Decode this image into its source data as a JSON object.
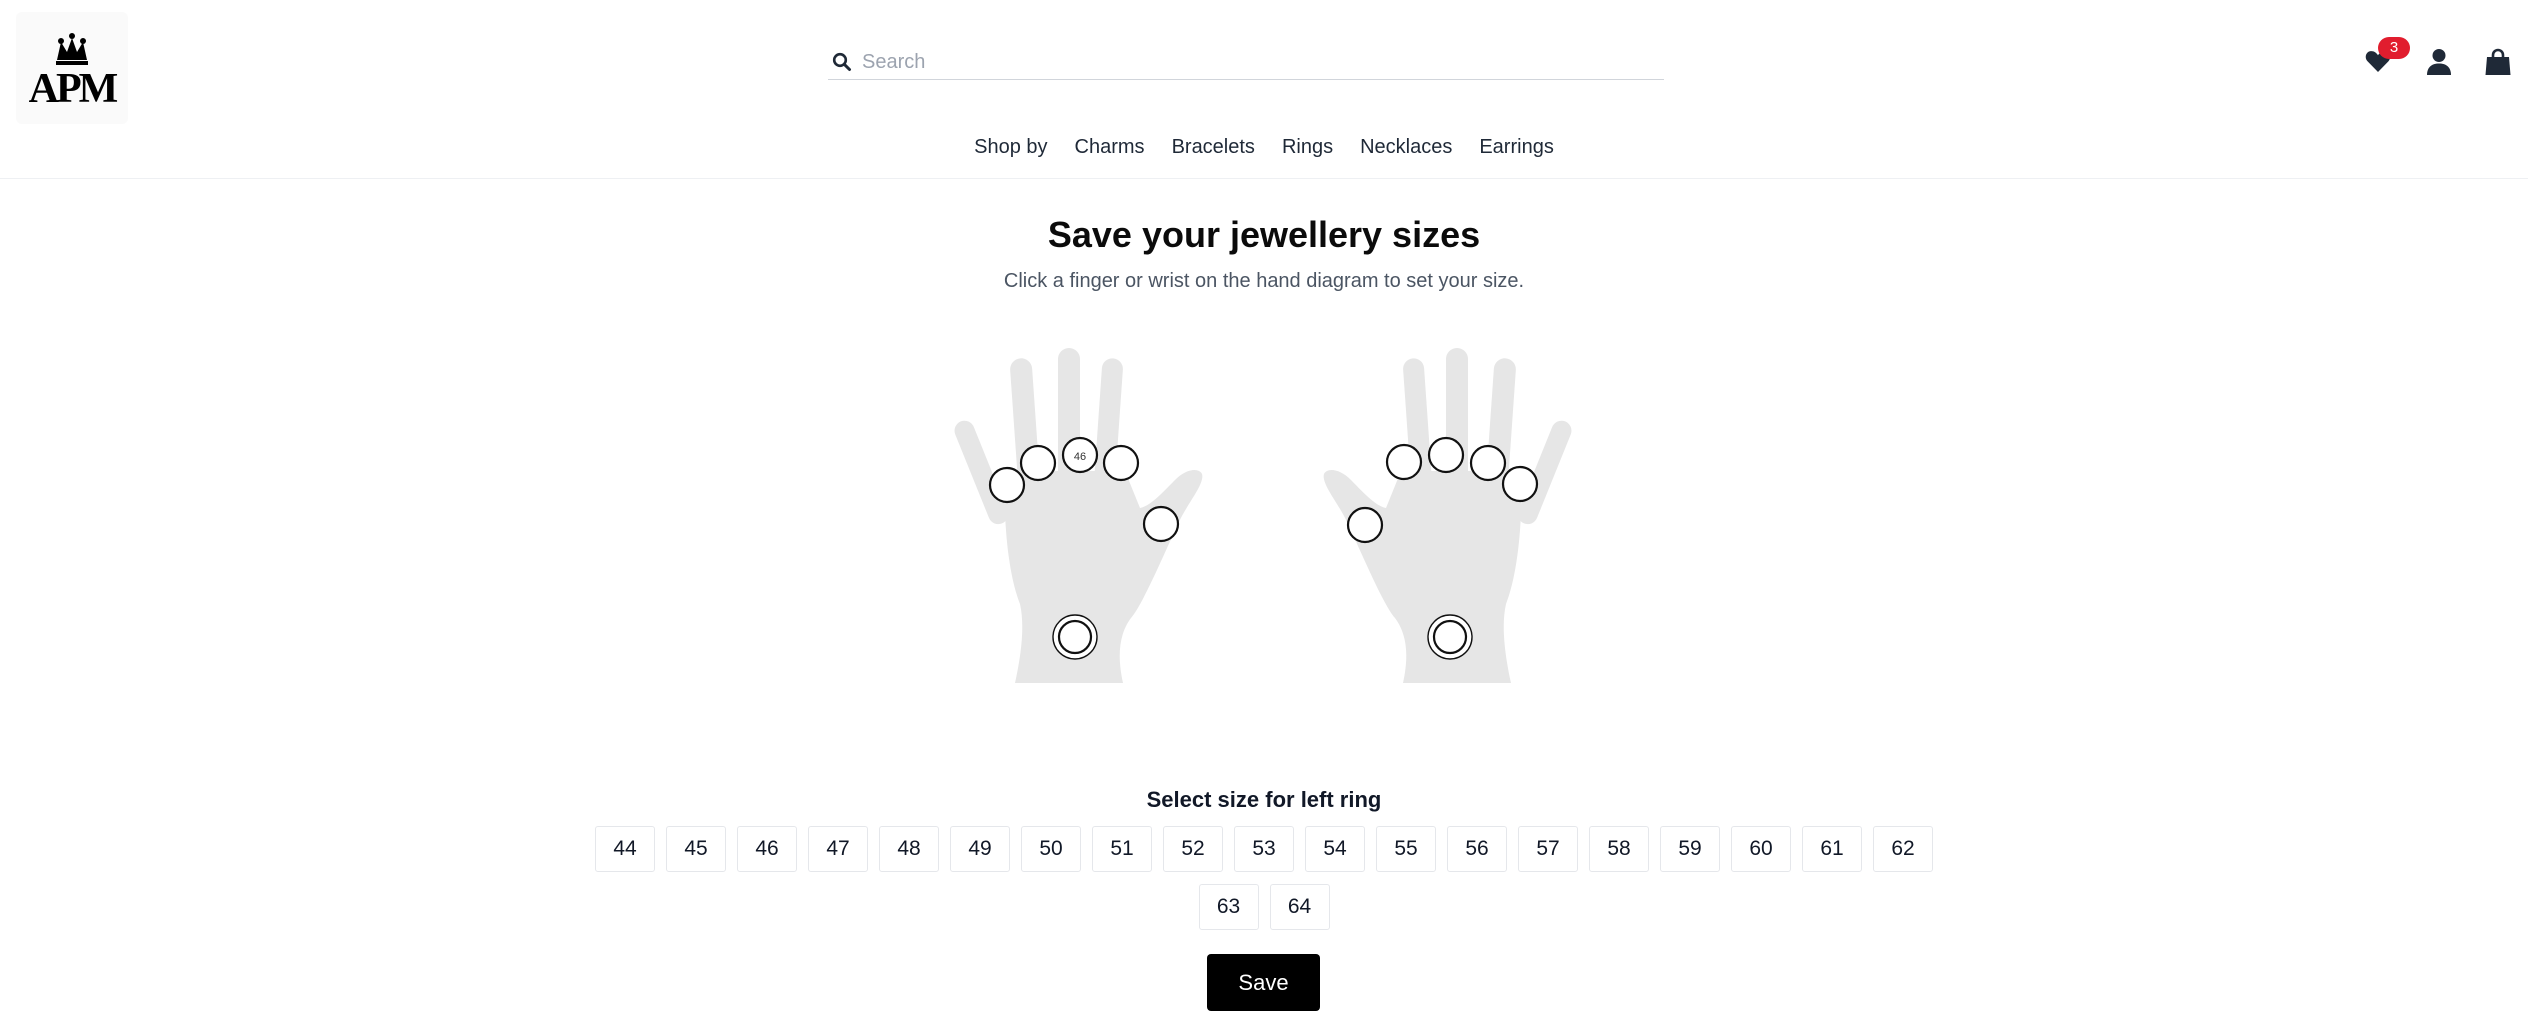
{
  "header": {
    "logo_text": "APM",
    "search": {
      "placeholder": "Search",
      "value": ""
    },
    "wishlist_count": "3",
    "icons": [
      "search-icon",
      "heart-icon",
      "user-icon",
      "shopping-bag-icon"
    ]
  },
  "nav": {
    "items": [
      "Shop by",
      "Charms",
      "Bracelets",
      "Rings",
      "Necklaces",
      "Earrings"
    ]
  },
  "page": {
    "title": "Save your jewellery sizes",
    "subtitle": "Click a finger or wrist on the hand diagram to set your size."
  },
  "hands": {
    "left": {
      "middle_finger_size": "46"
    }
  },
  "size_selector": {
    "label": "Select size for left ring",
    "sizes": [
      "44",
      "45",
      "46",
      "47",
      "48",
      "49",
      "50",
      "51",
      "52",
      "53",
      "54",
      "55",
      "56",
      "57",
      "58",
      "59",
      "60",
      "61",
      "62",
      "63",
      "64"
    ],
    "save_label": "Save"
  },
  "colors": {
    "accent": "#000000",
    "badge": "#e11d2e",
    "hand_fill": "#e6e6e6"
  }
}
